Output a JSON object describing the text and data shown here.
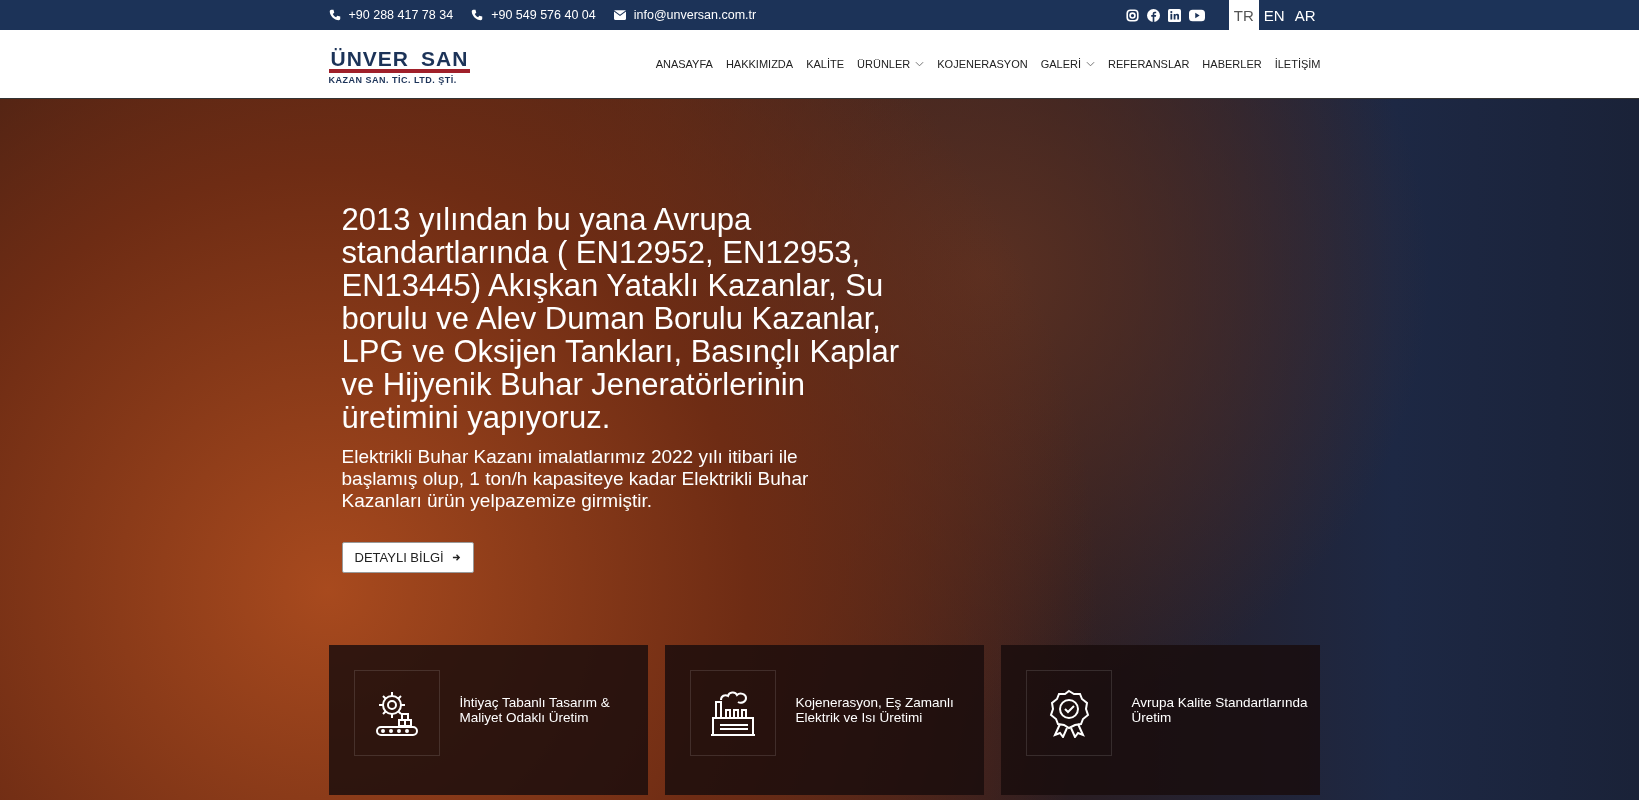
{
  "topbar": {
    "contacts": [
      {
        "kind": "phone",
        "text": "+90 288 417 78 34"
      },
      {
        "kind": "phone",
        "text": "+90 549 576 40 04"
      },
      {
        "kind": "mail",
        "text": "info@unversan.com.tr"
      }
    ],
    "social": [
      {
        "kind": "instagram"
      },
      {
        "kind": "facebook"
      },
      {
        "kind": "linkedin"
      },
      {
        "kind": "youtube"
      }
    ],
    "languages": [
      {
        "label": "TR",
        "selected": true
      },
      {
        "label": "EN",
        "selected": false
      },
      {
        "label": "AR",
        "selected": false
      }
    ]
  },
  "logo": {
    "name": "ÜNVER",
    "name2": "SAN",
    "subtitle": "KAZAN SAN. TİC. LTD. ŞTİ."
  },
  "nav": [
    {
      "label": "ANASAYFA",
      "dropdown": false
    },
    {
      "label": "HAKKIMIZDA",
      "dropdown": false
    },
    {
      "label": "KALİTE",
      "dropdown": false
    },
    {
      "label": "ÜRÜNLER",
      "dropdown": true
    },
    {
      "label": "KOJENERASYON",
      "dropdown": false
    },
    {
      "label": "GALERİ",
      "dropdown": true
    },
    {
      "label": "REFERANSLAR",
      "dropdown": false
    },
    {
      "label": "HABERLER",
      "dropdown": false
    },
    {
      "label": "İLETİŞİM",
      "dropdown": false
    }
  ],
  "hero": {
    "heading": "2013 yılından bu yana Avrupa standartlarında ( EN12952, EN12953, EN13445) Akışkan Yataklı Kazanlar, Su borulu ve Alev Duman Borulu Kazanlar, LPG ve Oksijen Tankları, Basınçlı Kaplar ve Hijyenik Buhar Jeneratörlerinin üretimini yapıyoruz.",
    "text": "Elektrikli Buhar Kazanı imalatlarımız 2022 yılı itibari ile başlamış olup, 1 ton/h kapasiteye kadar Elektrikli Buhar Kazanları ürün yelpazemize girmiştir.",
    "button": "DETAYLI BİLGİ"
  },
  "features": [
    {
      "kind": "gear",
      "title": "İhtiyaç Tabanlı Tasarım & Maliyet Odaklı Üretim"
    },
    {
      "kind": "factory",
      "title": "Kojenerasyon, Eş Zamanlı Elektrik ve Isı Üretimi"
    },
    {
      "kind": "award",
      "title": "Avrupa Kalite Standartlarında Üretim"
    }
  ]
}
